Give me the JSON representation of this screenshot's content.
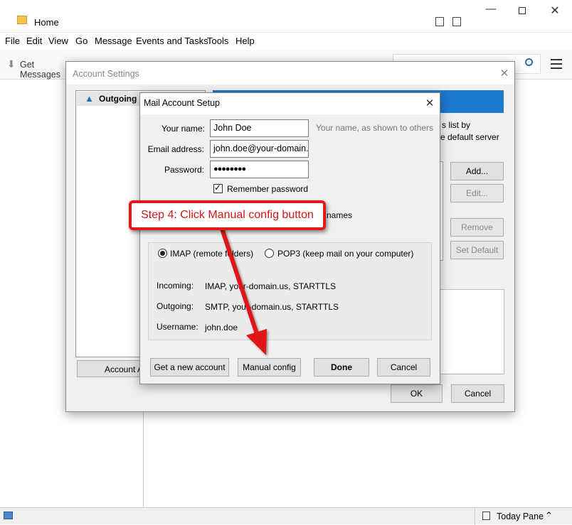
{
  "window": {
    "title": "Home"
  },
  "menu": [
    "File",
    "Edit",
    "View",
    "Go",
    "Message",
    "Events and Tasks",
    "Tools",
    "Help"
  ],
  "toolbar": {
    "get_messages": "Get Messages"
  },
  "account_settings": {
    "title": "Account Settings",
    "outgoing_item": "Outgoing S",
    "side_text_1": "s list by",
    "side_text_2": "e default server",
    "add_label": "Add...",
    "edit_label": "Edit...",
    "remove_label": "Remove",
    "set_default_label": "Set Default",
    "account_actions_label": "Account A",
    "ok_label": "OK",
    "cancel_label": "Cancel"
  },
  "mail_setup": {
    "title": "Mail Account Setup",
    "name_label": "Your name:",
    "name_value": "John Doe",
    "name_hint": "Your name, as shown to others",
    "email_label": "Email address:",
    "email_value": "john.doe@your-domain.",
    "password_label": "Password:",
    "password_value": "●●●●●●●●",
    "remember_label": "Remember password",
    "remember_checked": true,
    "hidden_text": "names",
    "imap_label": "IMAP (remote folders)",
    "pop3_label": "POP3 (keep mail on your computer)",
    "selected_protocol": "IMAP",
    "incoming_label": "Incoming:",
    "incoming_value": "IMAP, your-domain.us, STARTTLS",
    "outgoing_label": "Outgoing:",
    "outgoing_value": "SMTP, your-domain.us, STARTTLS",
    "username_label": "Username:",
    "username_value": "john.doe",
    "new_account_label": "Get a new account",
    "manual_config_label": "Manual config",
    "done_label": "Done",
    "cancel_label": "Cancel"
  },
  "callout": {
    "text": "Step 4: Click Manual config button",
    "color": "#e01818"
  },
  "status": {
    "today_pane": "Today Pane"
  }
}
